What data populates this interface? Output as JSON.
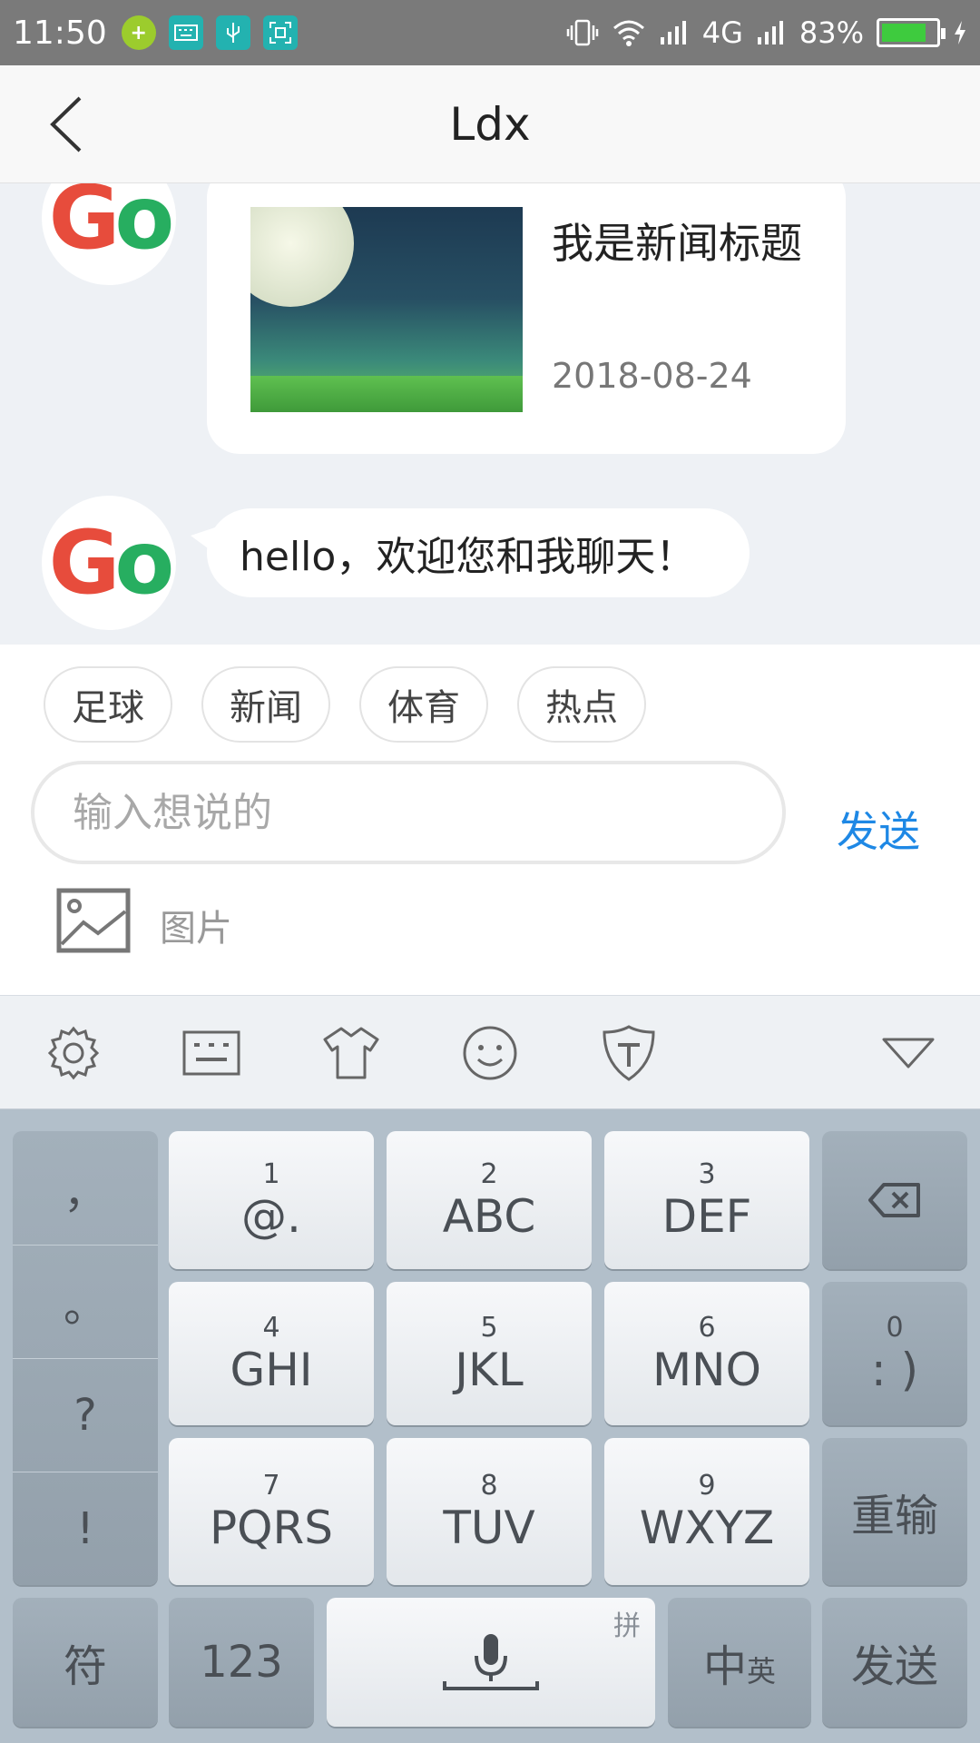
{
  "status_bar": {
    "time": "11:50",
    "network": "4G",
    "battery": "83%",
    "battery_level": 0.83
  },
  "header": {
    "title": "Ldx"
  },
  "chat": {
    "news_card": {
      "title": "我是新闻标题",
      "date": "2018-08-24"
    },
    "message": "hello，欢迎您和我聊天！"
  },
  "quick_tags": [
    "足球",
    "新闻",
    "体育",
    "热点"
  ],
  "input": {
    "placeholder": "输入想说的",
    "send_label": "发送",
    "image_label": "图片"
  },
  "keyboard": {
    "symbols": [
      "，",
      "。",
      "?",
      "!"
    ],
    "keys": [
      {
        "num": "1",
        "letters": "@."
      },
      {
        "num": "2",
        "letters": "ABC"
      },
      {
        "num": "3",
        "letters": "DEF"
      },
      {
        "num": "4",
        "letters": "GHI"
      },
      {
        "num": "5",
        "letters": "JKL"
      },
      {
        "num": "6",
        "letters": "MNO"
      },
      {
        "num": "7",
        "letters": "PQRS"
      },
      {
        "num": "8",
        "letters": "TUV"
      },
      {
        "num": "9",
        "letters": "WXYZ"
      }
    ],
    "zero": {
      "num": "0",
      "letters": ": )"
    },
    "reset": "重输",
    "symbol_key": "符",
    "number_key": "123",
    "pinyin_hint": "拼",
    "lang_main": "中",
    "lang_sub": "英",
    "send": "发送"
  },
  "colors": {
    "accent": "#1e88e5",
    "status_bar": "#7a7a7a"
  }
}
